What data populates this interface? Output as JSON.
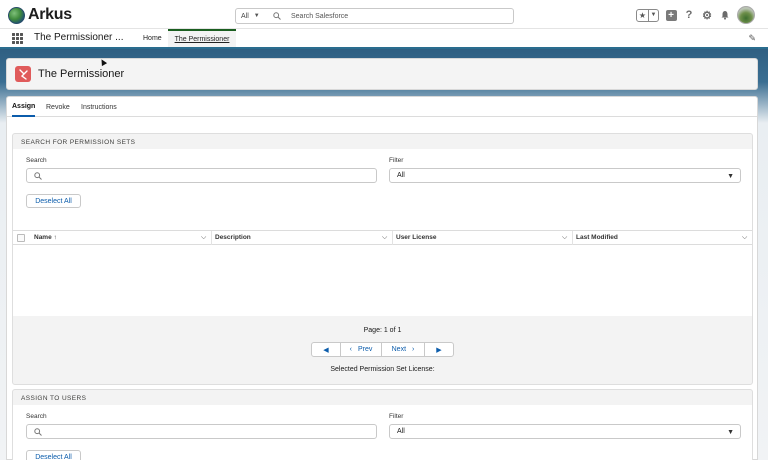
{
  "header": {
    "logo_text": "Arkus",
    "search_scope": "All",
    "search_placeholder": "Search Salesforce"
  },
  "nav": {
    "app_name": "The Permissioner ...",
    "items": [
      {
        "label": "Home"
      },
      {
        "label": "The Permissioner"
      }
    ]
  },
  "page": {
    "title": "The Permissioner"
  },
  "tabs": [
    {
      "label": "Assign"
    },
    {
      "label": "Revoke"
    },
    {
      "label": "Instructions"
    }
  ],
  "permission_sets": {
    "section_title": "SEARCH FOR PERMISSION SETS",
    "search_label": "Search",
    "filter_label": "Filter",
    "filter_value": "All",
    "deselect_label": "Deselect All",
    "columns": [
      {
        "label": "Name ↑"
      },
      {
        "label": "Description"
      },
      {
        "label": "User License"
      },
      {
        "label": "Last Modified"
      }
    ],
    "page_info": "Page: 1 of 1",
    "prev_label": "Prev",
    "next_label": "Next",
    "selected_license": "Selected Permission Set License:"
  },
  "assign_users": {
    "section_title": "ASSIGN TO USERS",
    "search_label": "Search",
    "filter_label": "Filter",
    "filter_value": "All",
    "deselect_label": "Deselect All"
  }
}
